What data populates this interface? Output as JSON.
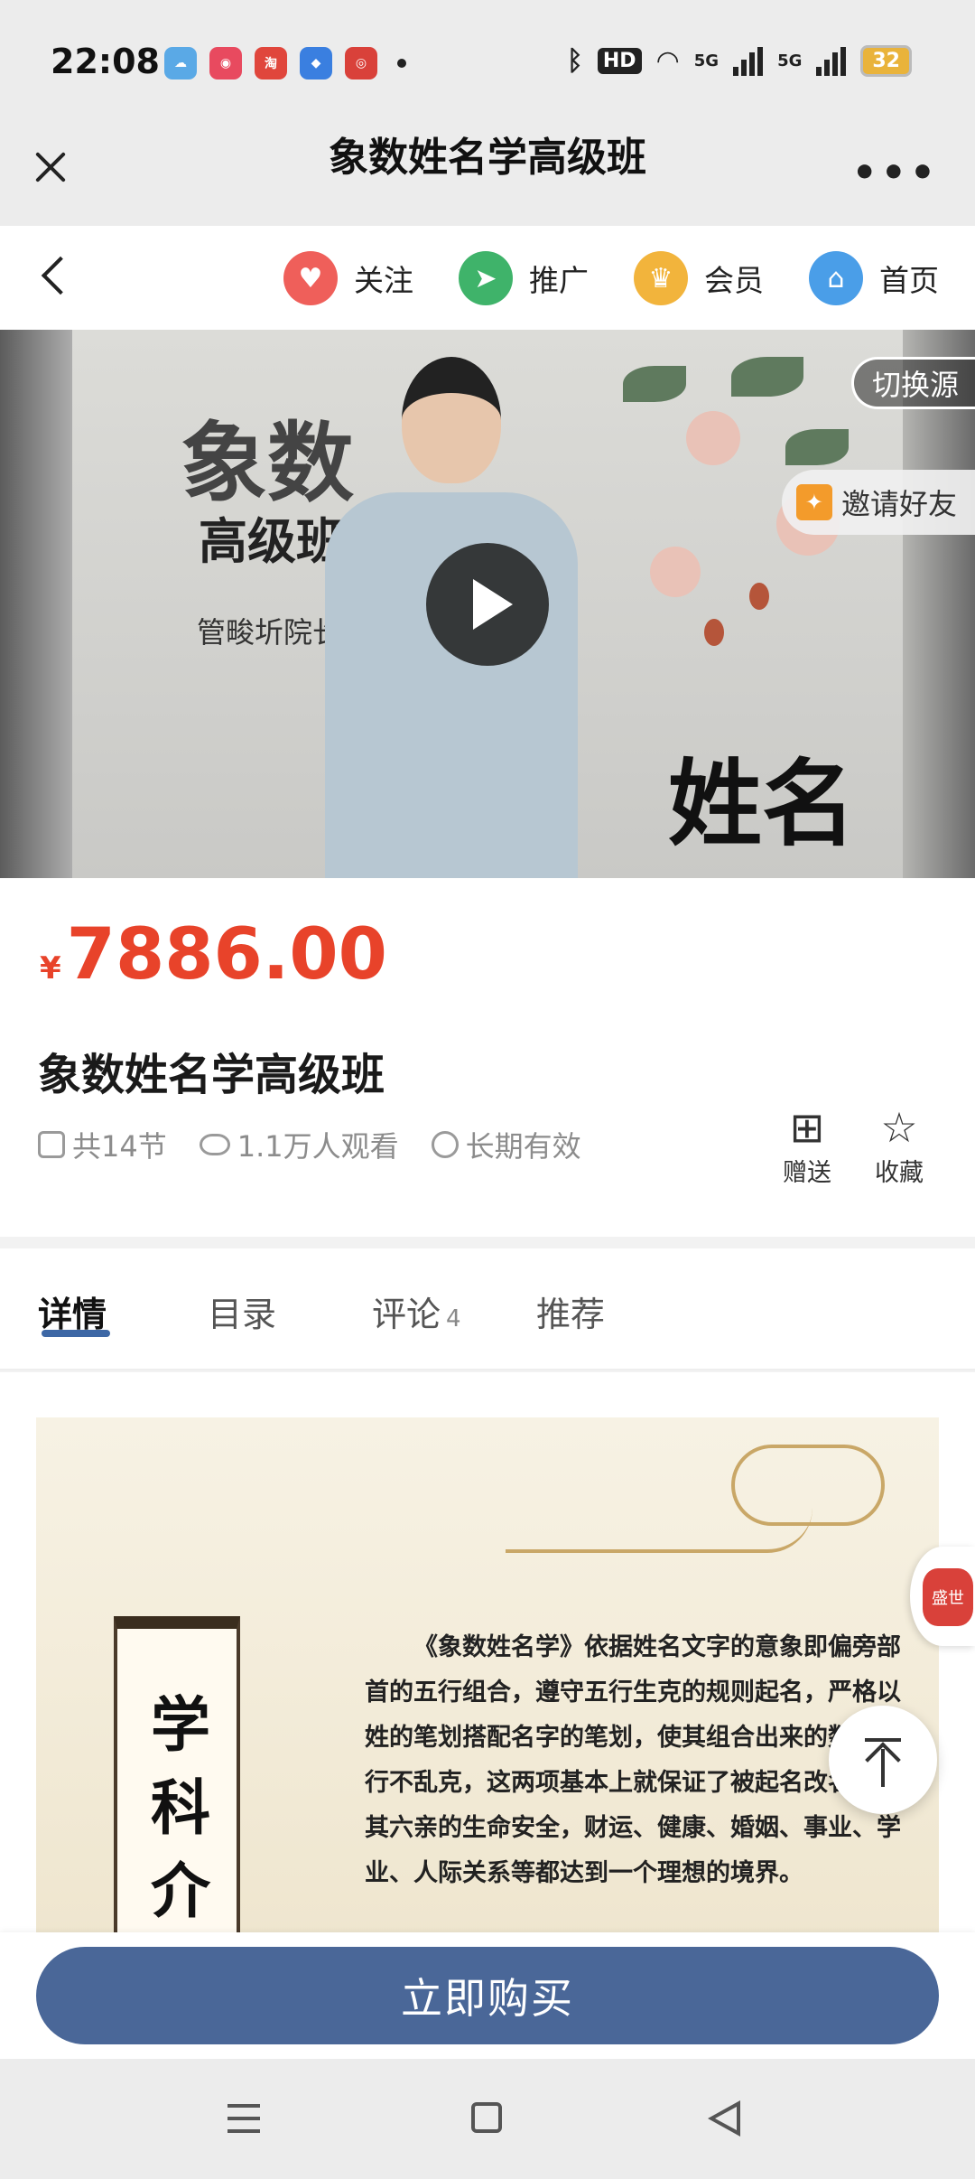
{
  "status_bar": {
    "time": "22:08",
    "hd_badge": "HD",
    "signal_1": "5G",
    "signal_2": "5G",
    "battery": "32"
  },
  "title_bar": {
    "title": "象数姓名学高级班"
  },
  "nav": {
    "items": [
      {
        "label": "关注",
        "icon": "heart-icon",
        "color": "#ef5f5a"
      },
      {
        "label": "推广",
        "icon": "send-icon",
        "color": "#3fb36a"
      },
      {
        "label": "会员",
        "icon": "crown-icon",
        "color": "#f2b43c"
      },
      {
        "label": "首页",
        "icon": "home-icon",
        "color": "#4a9ee8"
      }
    ]
  },
  "video": {
    "switch_source": "切换源",
    "invite_friends": "邀请好友",
    "cover_title_1": "象数",
    "cover_title_2": "高级班",
    "cover_teacher": "管畯圻院长",
    "cover_title_3": "姓名学"
  },
  "course": {
    "currency": "¥",
    "price": "7886.00",
    "title": "象数姓名学高级班",
    "sections": "共14节",
    "views": "1.1万人观看",
    "validity": "长期有效",
    "gift_label": "赠送",
    "favorite_label": "收藏"
  },
  "tabs": [
    {
      "label": "详情",
      "active": true
    },
    {
      "label": "目录"
    },
    {
      "label": "评论",
      "count": "4"
    },
    {
      "label": "推荐"
    }
  ],
  "content": {
    "scroll_title": "学科介绍",
    "paragraph": "《象数姓名学》依据姓名文字的意象即偏旁部首的五行组合，遵守五行生克的规则起名，严格以姓的笔划搭配名字的笔划，使其组合出来的数理五行不乱克，这两项基本上就保证了被起名改名人及其六亲的生命安全，财运、健康、婚姻、事业、学业、人际关系等都达到一个理想的境界。",
    "seal_text": "盛世"
  },
  "buy": {
    "button_label": "立即购买",
    "color": "#4a6798"
  },
  "colors": {
    "price": "#e8432a",
    "tab_accent": "#3d67a5"
  }
}
